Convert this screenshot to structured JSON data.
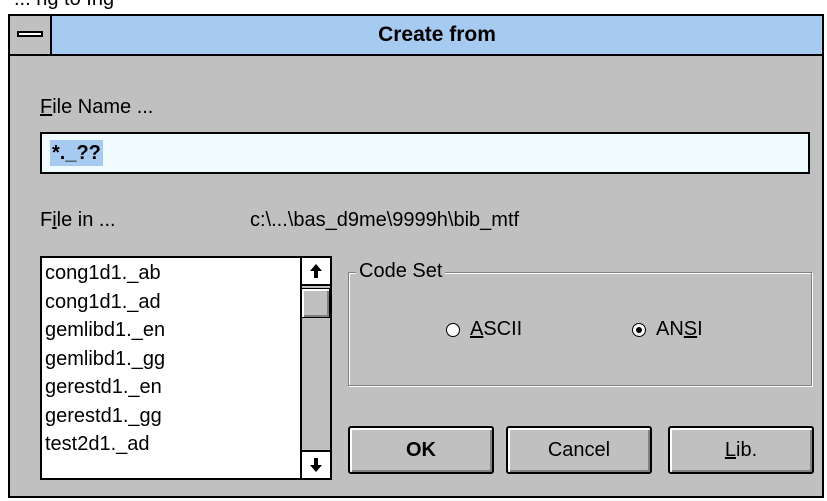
{
  "above_text": "... ng to Ing",
  "dialog": {
    "title": "Create from",
    "file_name_label_mnemonic": "F",
    "file_name_label_rest": "ile Name ...",
    "file_name_value": "*._??",
    "file_in_label_pre": "F",
    "file_in_label_mnemonic": "i",
    "file_in_label_rest": "le in ...",
    "directory_path": "c:\\...\\bas_d9me\\9999h\\bib_mtf",
    "files": [
      "cong1d1._ab",
      "cong1d1._ad",
      "gemlibd1._en",
      "gemlibd1._gg",
      "gerestd1._en",
      "gerestd1._gg",
      "test2d1._ad"
    ],
    "code_set": {
      "title": "Code Set",
      "ascii_mnemonic": "A",
      "ascii_rest": "SCII",
      "ansi_pre": "AN",
      "ansi_mnemonic": "S",
      "ansi_rest": "I",
      "selected": "ANSI"
    },
    "buttons": {
      "ok": "OK",
      "cancel": "Cancel",
      "lib_mnemonic": "L",
      "lib_rest": "ib."
    }
  }
}
